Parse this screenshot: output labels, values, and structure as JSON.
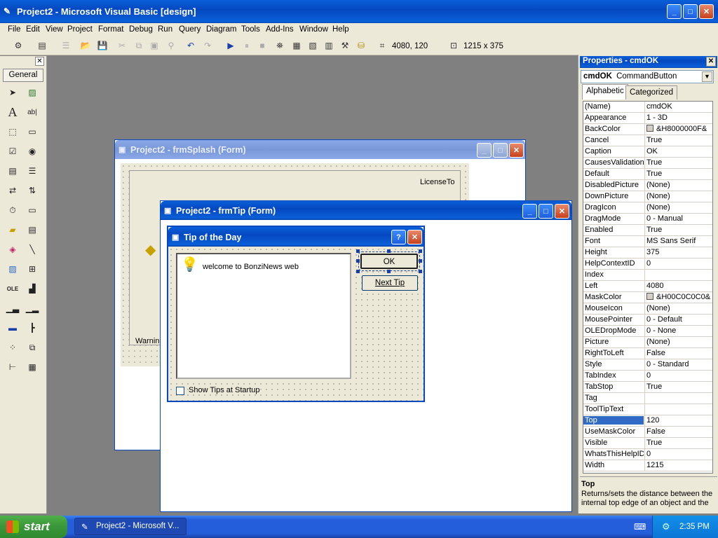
{
  "window": {
    "title": "Project2 - Microsoft Visual Basic [design]"
  },
  "menu": [
    "File",
    "Edit",
    "View",
    "Project",
    "Format",
    "Debug",
    "Run",
    "Query",
    "Diagram",
    "Tools",
    "Add-Ins",
    "Window",
    "Help"
  ],
  "toolbar": {
    "position_value": "4080, 120",
    "size_value": "1215 x 375"
  },
  "toolbox": {
    "tab_label": "General"
  },
  "forms": {
    "splash": {
      "title": "Project2 - frmSplash (Form)",
      "license_label": "LicenseTo",
      "warning_label": "Warnin"
    },
    "tip": {
      "title": "Project2 - frmTip (Form)"
    }
  },
  "dialog": {
    "title": "Tip of the Day",
    "help_glyph": "?",
    "close_glyph": "✕",
    "tip_text": "welcome to  BonziNews web",
    "ok_label": "OK",
    "next_label": "Next Tip",
    "checkbox_label": "Show Tips at Startup"
  },
  "properties": {
    "title": "Properties - cmdOK",
    "object_name": "cmdOK",
    "object_type": "CommandButton",
    "tab_alphabetic": "Alphabetic",
    "tab_categorized": "Categorized",
    "rows": [
      {
        "name": "(Name)",
        "value": "cmdOK"
      },
      {
        "name": "Appearance",
        "value": "1 - 3D"
      },
      {
        "name": "BackColor",
        "value": "&H8000000F&"
      },
      {
        "name": "Cancel",
        "value": "True"
      },
      {
        "name": "Caption",
        "value": "OK"
      },
      {
        "name": "CausesValidation",
        "value": "True"
      },
      {
        "name": "Default",
        "value": "True"
      },
      {
        "name": "DisabledPicture",
        "value": "(None)"
      },
      {
        "name": "DownPicture",
        "value": "(None)"
      },
      {
        "name": "DragIcon",
        "value": "(None)"
      },
      {
        "name": "DragMode",
        "value": "0 - Manual"
      },
      {
        "name": "Enabled",
        "value": "True"
      },
      {
        "name": "Font",
        "value": "MS Sans Serif"
      },
      {
        "name": "Height",
        "value": "375"
      },
      {
        "name": "HelpContextID",
        "value": "0"
      },
      {
        "name": "Index",
        "value": ""
      },
      {
        "name": "Left",
        "value": "4080"
      },
      {
        "name": "MaskColor",
        "value": "&H00C0C0C0&"
      },
      {
        "name": "MouseIcon",
        "value": "(None)"
      },
      {
        "name": "MousePointer",
        "value": "0 - Default"
      },
      {
        "name": "OLEDropMode",
        "value": "0 - None"
      },
      {
        "name": "Picture",
        "value": "(None)"
      },
      {
        "name": "RightToLeft",
        "value": "False"
      },
      {
        "name": "Style",
        "value": "0 - Standard"
      },
      {
        "name": "TabIndex",
        "value": "0"
      },
      {
        "name": "TabStop",
        "value": "True"
      },
      {
        "name": "Tag",
        "value": ""
      },
      {
        "name": "ToolTipText",
        "value": ""
      },
      {
        "name": "Top",
        "value": "120"
      },
      {
        "name": "UseMaskColor",
        "value": "False"
      },
      {
        "name": "Visible",
        "value": "True"
      },
      {
        "name": "WhatsThisHelpID",
        "value": "0"
      },
      {
        "name": "Width",
        "value": "1215"
      }
    ],
    "desc_title": "Top",
    "desc_text": "Returns/sets the distance between the internal top edge of an object and the"
  },
  "taskbar": {
    "start_label": "start",
    "task_label": "Project2 - Microsoft V...",
    "clock": "2:35 PM"
  }
}
